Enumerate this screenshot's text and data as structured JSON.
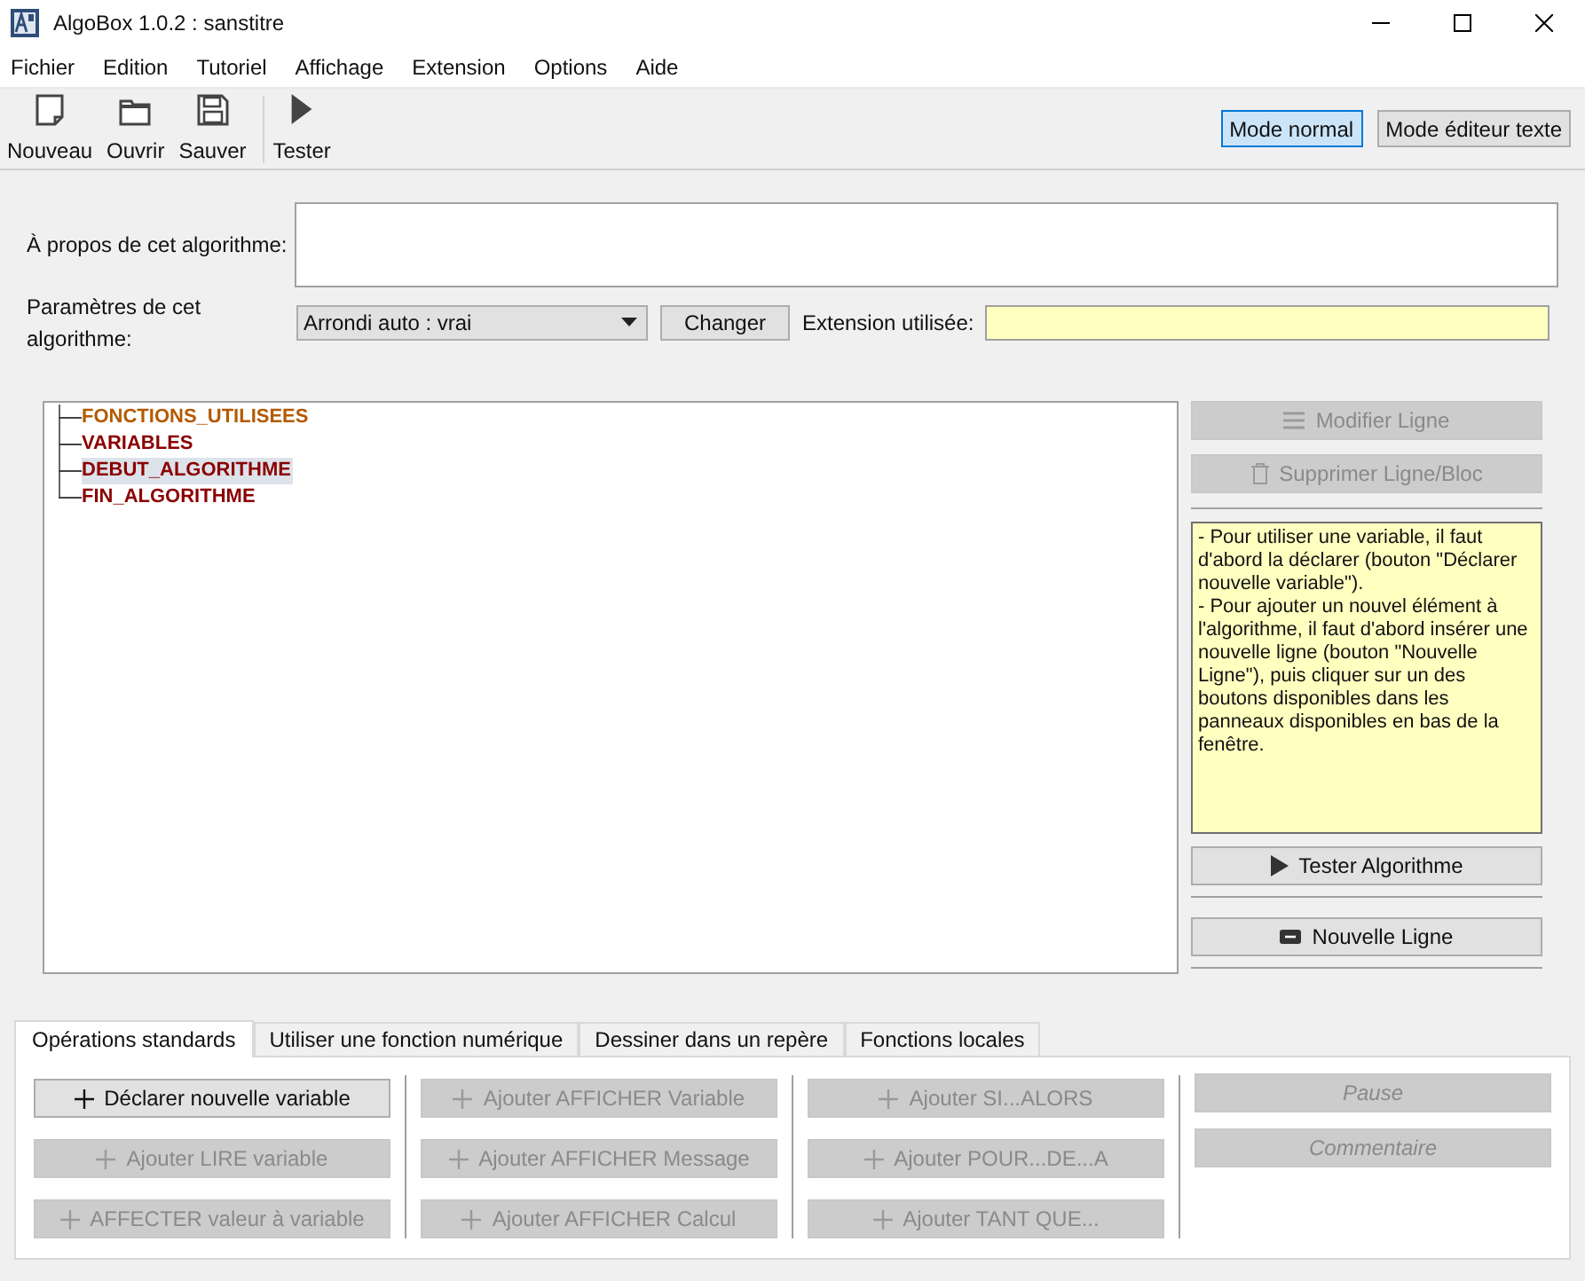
{
  "window": {
    "title": "AlgoBox 1.0.2 : sanstitre"
  },
  "menu": [
    "Fichier",
    "Edition",
    "Tutoriel",
    "Affichage",
    "Extension",
    "Options",
    "Aide"
  ],
  "toolbar": [
    {
      "kind": "new",
      "label": "Nouveau"
    },
    {
      "kind": "open",
      "label": "Ouvrir"
    },
    {
      "kind": "save",
      "label": "Sauver"
    },
    {
      "kind": "run",
      "label": "Tester"
    }
  ],
  "modes": [
    {
      "label": "Mode normal",
      "selected": true
    },
    {
      "label": "Mode éditeur texte",
      "selected": false
    }
  ],
  "about": {
    "label": "À propos de cet algorithme:"
  },
  "params": {
    "label": "Paramètres de cet algorithme:",
    "value": "Arrondi auto : vrai",
    "button": "Changer",
    "extension_label": "Extension utilisée:"
  },
  "tree": [
    {
      "text": "FONCTIONS_UTILISEES",
      "color": "#b35a00",
      "selected": false
    },
    {
      "text": "VARIABLES",
      "color": "#8b0000",
      "selected": false
    },
    {
      "text": "DEBUT_ALGORITHME",
      "color": "#8b0000",
      "selected": true
    },
    {
      "text": "FIN_ALGORITHME",
      "color": "#8b0000",
      "selected": false
    }
  ],
  "side_buttons": [
    {
      "kind": "edit",
      "label": "Modifier Ligne",
      "disabled": true
    },
    {
      "kind": "delete",
      "label": "Supprimer Ligne/Bloc",
      "disabled": true
    }
  ],
  "help": [
    "- Pour utiliser une variable, il faut d'abord la déclarer (bouton \"Déclarer nouvelle variable\").",
    "- Pour ajouter un nouvel élément à l'algorithme, il faut d'abord insérer une nouvelle ligne (bouton \"Nouvelle Ligne\"), puis cliquer sur un des boutons disponibles dans les panneaux disponibles en bas de la fenêtre."
  ],
  "run_button": {
    "kind": "run",
    "label": "Tester Algorithme",
    "disabled": false
  },
  "newline_button": {
    "kind": "newline",
    "label": "Nouvelle Ligne",
    "disabled": false
  },
  "tabs": [
    {
      "label": "Opérations standards",
      "selected": true
    },
    {
      "label": "Utiliser une fonction numérique",
      "selected": false
    },
    {
      "label": "Dessiner dans un repère",
      "selected": false
    },
    {
      "label": "Fonctions locales",
      "selected": false
    }
  ],
  "operations": [
    [
      {
        "kind": "add",
        "label": "Déclarer nouvelle variable",
        "disabled": false
      },
      {
        "kind": "add",
        "label": "Ajouter LIRE variable",
        "disabled": true
      },
      {
        "kind": "add",
        "label": "AFFECTER valeur à variable",
        "disabled": true
      }
    ],
    [
      {
        "kind": "add",
        "label": "Ajouter AFFICHER Variable",
        "disabled": true
      },
      {
        "kind": "add",
        "label": "Ajouter AFFICHER Message",
        "disabled": true
      },
      {
        "kind": "add",
        "label": "Ajouter AFFICHER Calcul",
        "disabled": true
      }
    ],
    [
      {
        "kind": "add",
        "label": "Ajouter SI...ALORS",
        "disabled": true
      },
      {
        "kind": "add",
        "label": "Ajouter POUR...DE...A",
        "disabled": true
      },
      {
        "kind": "add",
        "label": "Ajouter TANT QUE...",
        "disabled": true
      }
    ],
    [
      {
        "kind": "note",
        "label": "Pause",
        "disabled": true
      },
      {
        "kind": "note",
        "label": "Commentaire",
        "disabled": true
      }
    ]
  ]
}
